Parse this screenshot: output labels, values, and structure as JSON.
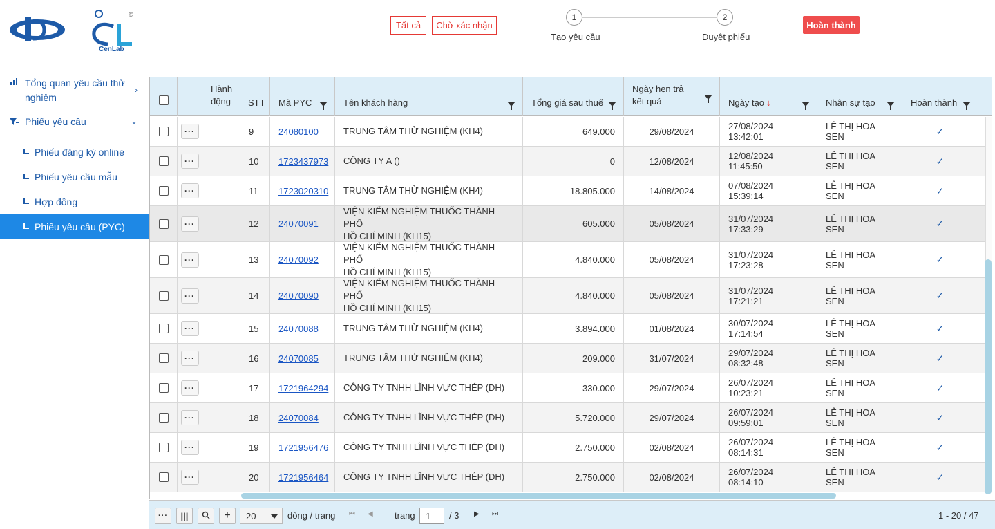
{
  "brand": {
    "name": "CenLab"
  },
  "sidebar": {
    "items": [
      {
        "label": "Tổng quan yêu cầu thử nghiệm",
        "icon": "chart-icon"
      },
      {
        "label": "Phiếu yêu cầu",
        "icon": "filter-list-icon"
      }
    ],
    "sub_items": [
      {
        "label": "Phiếu đăng ký online"
      },
      {
        "label": "Phiếu yêu cầu mẫu"
      },
      {
        "label": "Hợp đồng"
      },
      {
        "label": "Phiếu yêu cầu (PYC)"
      }
    ]
  },
  "filters": {
    "all": "Tất cả",
    "pending": "Chờ xác nhận",
    "done": "Hoàn thành"
  },
  "steps": [
    {
      "num": "1",
      "label": "Tạo yêu cầu"
    },
    {
      "num": "2",
      "label": "Duyệt phiếu"
    }
  ],
  "columns": {
    "action_1": "Hành",
    "action_2": "động",
    "stt": "STT",
    "code": "Mã PYC",
    "customer": "Tên khách hàng",
    "total": "Tổng giá sau thuế",
    "due_1": "Ngày hẹn trả",
    "due_2": "kết quả",
    "created": "Ngày tạo",
    "created_sort": "↓",
    "staff": "Nhân sự tạo",
    "done": "Hoàn thành"
  },
  "rows": [
    {
      "stt": "9",
      "code": "24080100",
      "customer_1": "TRUNG TÂM THỬ NGHIỆM (KH4)",
      "customer_2": "",
      "total": "649.000",
      "due": "29/08/2024",
      "created": "27/08/2024 13:42:01",
      "staff": "LÊ THỊ HOA SEN"
    },
    {
      "stt": "10",
      "code": "1723437973",
      "customer_1": "CÔNG TY A ()",
      "customer_2": "",
      "total": "0",
      "due": "12/08/2024",
      "created": "12/08/2024 11:45:50",
      "staff": "LÊ THỊ HOA SEN"
    },
    {
      "stt": "11",
      "code": "1723020310",
      "customer_1": "TRUNG TÂM THỬ NGHIỆM (KH4)",
      "customer_2": "",
      "total": "18.805.000",
      "due": "14/08/2024",
      "created": "07/08/2024 15:39:14",
      "staff": "LÊ THỊ HOA SEN"
    },
    {
      "stt": "12",
      "code": "24070091",
      "customer_1": "VIỆN KIỂM NGHIỆM THUỐC THÀNH PHỐ",
      "customer_2": "HỒ CHÍ MINH (KH15)",
      "total": "605.000",
      "due": "05/08/2024",
      "created": "31/07/2024 17:33:29",
      "staff": "LÊ THỊ HOA SEN"
    },
    {
      "stt": "13",
      "code": "24070092",
      "customer_1": "VIỆN KIỂM NGHIỆM THUỐC THÀNH PHỐ",
      "customer_2": "HỒ CHÍ MINH (KH15)",
      "total": "4.840.000",
      "due": "05/08/2024",
      "created": "31/07/2024 17:23:28",
      "staff": "LÊ THỊ HOA SEN"
    },
    {
      "stt": "14",
      "code": "24070090",
      "customer_1": "VIỆN KIỂM NGHIỆM THUỐC THÀNH PHỐ",
      "customer_2": "HỒ CHÍ MINH (KH15)",
      "total": "4.840.000",
      "due": "05/08/2024",
      "created": "31/07/2024 17:21:21",
      "staff": "LÊ THỊ HOA SEN"
    },
    {
      "stt": "15",
      "code": "24070088",
      "customer_1": "TRUNG TÂM THỬ NGHIỆM (KH4)",
      "customer_2": "",
      "total": "3.894.000",
      "due": "01/08/2024",
      "created": "30/07/2024 17:14:54",
      "staff": "LÊ THỊ HOA SEN"
    },
    {
      "stt": "16",
      "code": "24070085",
      "customer_1": "TRUNG TÂM THỬ NGHIỆM (KH4)",
      "customer_2": "",
      "total": "209.000",
      "due": "31/07/2024",
      "created": "29/07/2024 08:32:48",
      "staff": "LÊ THỊ HOA SEN"
    },
    {
      "stt": "17",
      "code": "1721964294",
      "customer_1": "CÔNG TY TNHH LĨNH VỰC THÉP (DH)",
      "customer_2": "",
      "total": "330.000",
      "due": "29/07/2024",
      "created": "26/07/2024 10:23:21",
      "staff": "LÊ THỊ HOA SEN"
    },
    {
      "stt": "18",
      "code": "24070084",
      "customer_1": "CÔNG TY TNHH LĨNH VỰC THÉP (DH)",
      "customer_2": "",
      "total": "5.720.000",
      "due": "29/07/2024",
      "created": "26/07/2024 09:59:01",
      "staff": "LÊ THỊ HOA SEN"
    },
    {
      "stt": "19",
      "code": "1721956476",
      "customer_1": "CÔNG TY TNHH LĨNH VỰC THÉP (DH)",
      "customer_2": "",
      "total": "2.750.000",
      "due": "02/08/2024",
      "created": "26/07/2024 08:14:31",
      "staff": "LÊ THỊ HOA SEN"
    },
    {
      "stt": "20",
      "code": "1721956464",
      "customer_1": "CÔNG TY TNHH LĨNH VỰC THÉP (DH)",
      "customer_2": "",
      "total": "2.750.000",
      "due": "02/08/2024",
      "created": "26/07/2024 08:14:10",
      "staff": "LÊ THỊ HOA SEN"
    }
  ],
  "footer": {
    "page_size": "20",
    "per_page_label": "dòng / trang",
    "page_label": "trang",
    "page": "1",
    "total_pages": "/ 3",
    "range": "1 - 20 / 47"
  },
  "colors": {
    "accent": "#1e88e5",
    "danger": "#ef4d4d",
    "header_bg": "#ddeef8",
    "link": "#1a56c4"
  }
}
